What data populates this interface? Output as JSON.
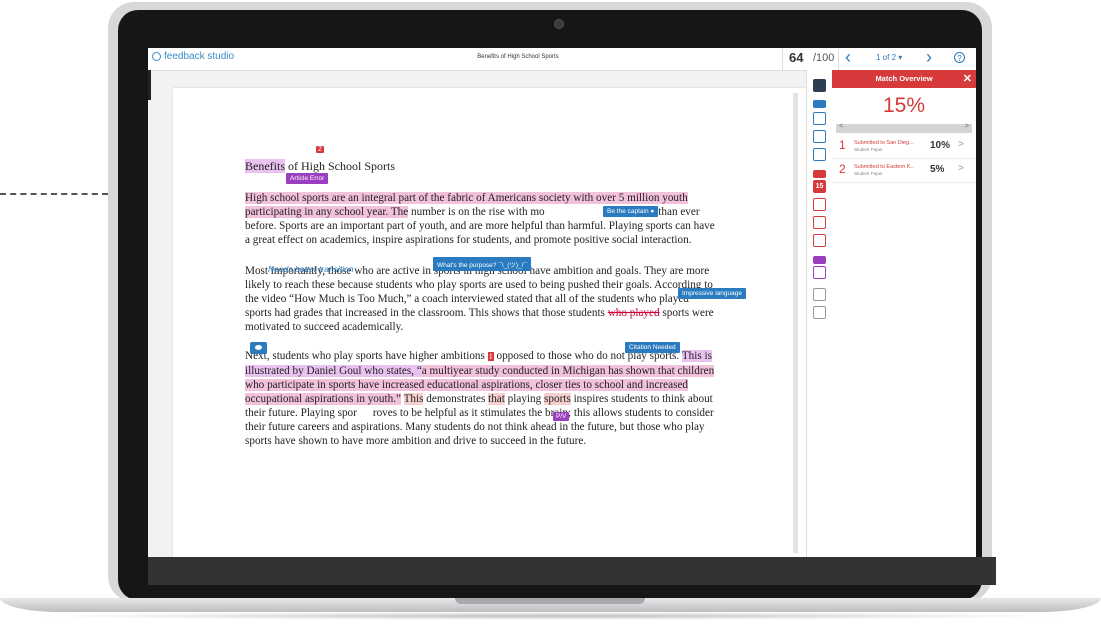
{
  "app": {
    "logo_text": "feedback studio",
    "doc_title": "Benefits of High School Sports",
    "score": "64",
    "score_total": "/100",
    "page_indicator": "1 of 2 ▾",
    "prev_icon": "chevron-left-icon",
    "next_icon": "chevron-right-icon",
    "help_symbol": "?"
  },
  "document": {
    "title_word_highlighted": "Benefits",
    "title_rest": " of High School Sports",
    "title_marker": "2",
    "para1": {
      "seg1": "High school sports are an integral part of the fabric of Americans society with over 5 million youth participating in any school year. The",
      "seg2": " number is on the rise with mo",
      "seg3": "orts now than ever before. Sports are an important part of youth, and are more helpful than harmful. Playing sports can have a great effect on academics, inspire aspirations for students, and promote positive social interaction."
    },
    "para2": {
      "seg1": "Most importantly, those who are active in sports in high school have ambition and goals. They are more likely to reach these because students who play sports are used to being pushed",
      "seg2": " their goals. According to the video “How Much is Too Much,” a coach interviewed stated that all of the students who played sports had grades that increased in the classroom. This shows that those students ",
      "strike": "who played",
      "seg3": " sports were motivated to succeed academically."
    },
    "para3": {
      "seg1": "Next, students who play sports have higher ambitions ",
      "marker": "1",
      "seg2": " opposed to those who do not play sports. ",
      "hl1": "This is illustrated by Daniel Goul who states, “",
      "hl2": "a multiyear study conducted in Michigan has shown that children who participate in sports have increased educational aspirations, closer ties to school and increased occupational aspirations in youth.”",
      "seg3": " ",
      "hl3": "This",
      "seg4": " demonstrates ",
      "hl4": "that",
      "seg5": " playing ",
      "hl5": "sports",
      "seg6": " inspires students to think about their future. Playing spor",
      "seg7": "roves to be helpful as it stimulates the brain; this allows students to consider their future careers and aspirations. Many students do not think ahead in the future, but those who play sports have shown to have more ambition and drive to succeed in the future."
    }
  },
  "annotations": {
    "article_error": "Article Error",
    "be_captain": "Be the captain",
    "purpose": "What's the purpose? ¯\\_(ツ)_/¯",
    "needs_transition": "Needs better transition",
    "impressive": "Impressive language",
    "citation": "Citation Needed",
    "pv": "P/V"
  },
  "toolbar": {
    "match_count": "15"
  },
  "panel": {
    "header": "Match Overview",
    "close_symbol": "✕",
    "overall_pct": "15%",
    "pager_left": "<",
    "pager_right": ">",
    "sources": [
      {
        "num": "1",
        "name": "Submitted to San Dieg...",
        "type": "Student Paper",
        "pct": "10%",
        "arrow": ">"
      },
      {
        "num": "2",
        "name": "Submitted to Eastern K...",
        "type": "Student Paper",
        "pct": "5%",
        "arrow": ">"
      }
    ]
  },
  "colors": {
    "accent_blue": "#2a7bbf",
    "match_red": "#d63a3a",
    "grammar_purple": "#9b3fc0"
  }
}
